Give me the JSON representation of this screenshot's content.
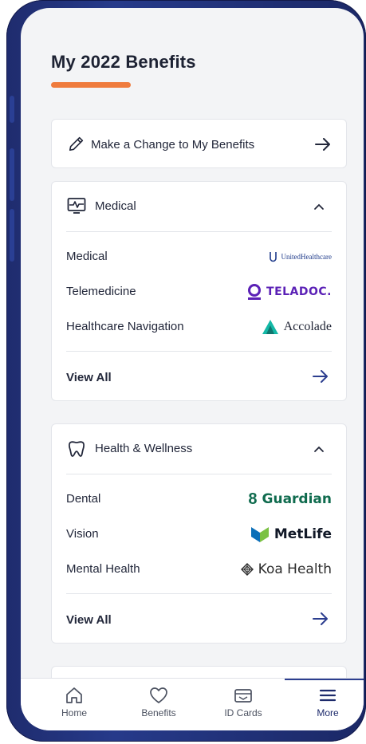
{
  "page": {
    "title": "My 2022 Benefits"
  },
  "change_card": {
    "label": "Make a Change to My Benefits"
  },
  "medical": {
    "heading": "Medical",
    "rows": [
      {
        "label": "Medical",
        "logo_text": "UnitedHealthcare"
      },
      {
        "label": "Telemedicine",
        "logo_text": "TELADOC."
      },
      {
        "label": "Healthcare Navigation",
        "logo_text": "Accolade"
      }
    ],
    "view_all": "View All"
  },
  "wellness": {
    "heading": "Health & Wellness",
    "rows": [
      {
        "label": "Dental",
        "logo_text": "Guardian"
      },
      {
        "label": "Vision",
        "logo_text": "MetLife"
      },
      {
        "label": "Mental Health",
        "logo_text": "Koa Health"
      }
    ],
    "view_all": "View All"
  },
  "bottom_nav": {
    "items": [
      {
        "label": "Home",
        "icon": "home-icon"
      },
      {
        "label": "Benefits",
        "icon": "heart-icon"
      },
      {
        "label": "ID Cards",
        "icon": "id-card-icon"
      },
      {
        "label": "More",
        "icon": "menu-icon"
      }
    ],
    "active": "More"
  },
  "colors": {
    "accent": "#ef7b3d",
    "frame": "#263a8a",
    "teladoc": "#5b21b6",
    "accolade": "#14b8a6",
    "guardian": "#0f6b4e",
    "metlife_blue": "#0b6fb8",
    "metlife_green": "#7ac143"
  }
}
